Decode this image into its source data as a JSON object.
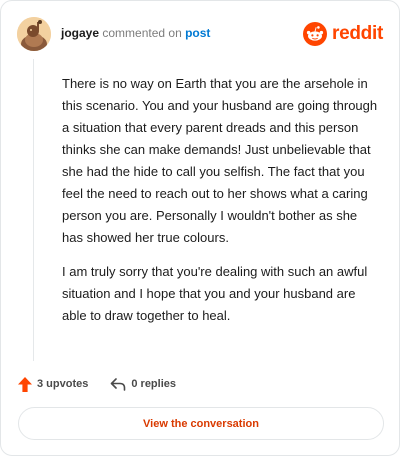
{
  "header": {
    "username": "jogaye",
    "action_text": "commented on",
    "post_link": "post",
    "logo_text": "reddit"
  },
  "comment": {
    "paragraphs": [
      "There is no way on Earth that you are the arsehole in this scenario. You and your husband are going through a situation that every parent dreads and this person thinks she can make demands! Just unbelievable that she had the hide to call you selfish. The fact that you feel the need to reach out to her shows what a caring person you are. Personally I wouldn't bother as she has showed her true colours.",
      "I am truly sorry that you're dealing with such an awful situation and I hope that you and your husband are able to draw together to heal."
    ]
  },
  "footer": {
    "upvotes_label": "3 upvotes",
    "replies_label": "0 replies",
    "view_button": "View the conversation"
  },
  "icons": {
    "avatar": "user-avatar-icon",
    "logo": "reddit-alien-icon",
    "upvote": "upvote-arrow-icon",
    "reply": "reply-arrow-icon"
  },
  "colors": {
    "brand": "#ff4500",
    "link": "#0079d3",
    "button_text": "#d93a00",
    "border": "#e3e6e8"
  }
}
